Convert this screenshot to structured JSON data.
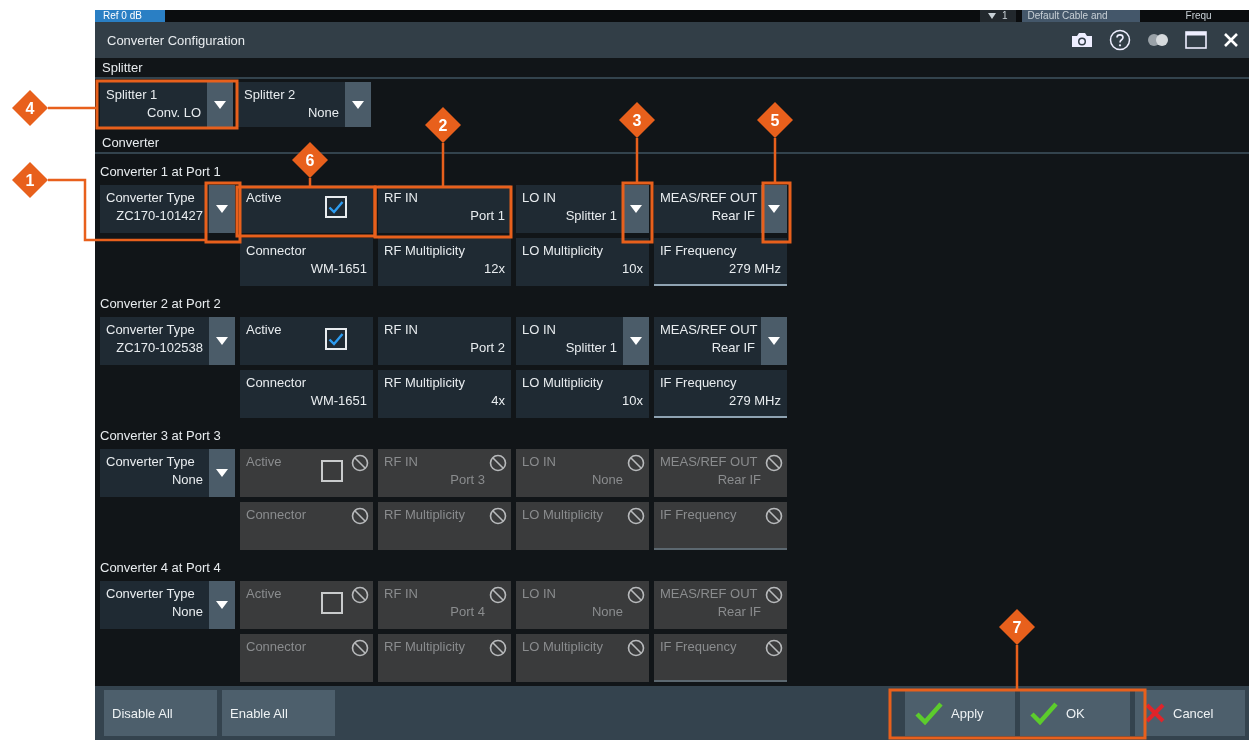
{
  "background_strip": {
    "tab": "Ref 0 dB",
    "channel": "1",
    "cable": "Default Cable and",
    "frequency": "Frequ"
  },
  "window": {
    "title": "Converter Configuration"
  },
  "splitter": {
    "heading": "Splitter",
    "items": [
      {
        "label": "Splitter 1",
        "value": "Conv. LO"
      },
      {
        "label": "Splitter 2",
        "value": "None"
      }
    ]
  },
  "converter": {
    "heading": "Converter",
    "groups": [
      {
        "title": "Converter 1 at Port 1",
        "type": {
          "label": "Converter Type",
          "value": "ZC170-101427"
        },
        "cells": [
          {
            "kind": "checkbox",
            "label": "Active",
            "checked": true,
            "disabled": false
          },
          {
            "kind": "value",
            "label": "RF IN",
            "value": "Port 1",
            "disabled": false
          },
          {
            "kind": "dropdown",
            "label": "LO IN",
            "value": "Splitter 1",
            "disabled": false
          },
          {
            "kind": "dropdown",
            "label": "MEAS/REF OUT",
            "value": "Rear IF",
            "disabled": false
          },
          {
            "kind": "value",
            "label": "Connector",
            "value": "WM-1651",
            "disabled": false
          },
          {
            "kind": "value",
            "label": "RF Multiplicity",
            "value": "12x",
            "disabled": false
          },
          {
            "kind": "value",
            "label": "LO Multiplicity",
            "value": "10x",
            "disabled": false
          },
          {
            "kind": "field",
            "label": "IF Frequency",
            "value": "279 MHz",
            "disabled": false
          }
        ]
      },
      {
        "title": "Converter 2 at Port 2",
        "type": {
          "label": "Converter Type",
          "value": "ZC170-102538"
        },
        "cells": [
          {
            "kind": "checkbox",
            "label": "Active",
            "checked": true,
            "disabled": false
          },
          {
            "kind": "value",
            "label": "RF IN",
            "value": "Port 2",
            "disabled": false
          },
          {
            "kind": "dropdown",
            "label": "LO IN",
            "value": "Splitter 1",
            "disabled": false
          },
          {
            "kind": "dropdown",
            "label": "MEAS/REF OUT",
            "value": "Rear IF",
            "disabled": false
          },
          {
            "kind": "value",
            "label": "Connector",
            "value": "WM-1651",
            "disabled": false
          },
          {
            "kind": "value",
            "label": "RF Multiplicity",
            "value": "4x",
            "disabled": false
          },
          {
            "kind": "value",
            "label": "LO Multiplicity",
            "value": "10x",
            "disabled": false
          },
          {
            "kind": "field",
            "label": "IF Frequency",
            "value": "279 MHz",
            "disabled": false
          }
        ]
      },
      {
        "title": "Converter 3 at Port 3",
        "type": {
          "label": "Converter Type",
          "value": "None"
        },
        "cells": [
          {
            "kind": "checkbox",
            "label": "Active",
            "checked": false,
            "disabled": true
          },
          {
            "kind": "value",
            "label": "RF IN",
            "value": "Port 3",
            "disabled": true
          },
          {
            "kind": "dropdown",
            "label": "LO IN",
            "value": "None",
            "disabled": true
          },
          {
            "kind": "dropdown",
            "label": "MEAS/REF OUT",
            "value": "Rear IF",
            "disabled": true
          },
          {
            "kind": "value",
            "label": "Connector",
            "disabled": true
          },
          {
            "kind": "value",
            "label": "RF Multiplicity",
            "disabled": true
          },
          {
            "kind": "value",
            "label": "LO Multiplicity",
            "disabled": true
          },
          {
            "kind": "field",
            "label": "IF Frequency",
            "disabled": true
          }
        ]
      },
      {
        "title": "Converter 4 at Port 4",
        "type": {
          "label": "Converter Type",
          "value": "None"
        },
        "cells": [
          {
            "kind": "checkbox",
            "label": "Active",
            "checked": false,
            "disabled": true
          },
          {
            "kind": "value",
            "label": "RF IN",
            "value": "Port 4",
            "disabled": true
          },
          {
            "kind": "dropdown",
            "label": "LO IN",
            "value": "None",
            "disabled": true
          },
          {
            "kind": "dropdown",
            "label": "MEAS/REF OUT",
            "value": "Rear IF",
            "disabled": true
          },
          {
            "kind": "value",
            "label": "Connector",
            "disabled": true
          },
          {
            "kind": "value",
            "label": "RF Multiplicity",
            "disabled": true
          },
          {
            "kind": "value",
            "label": "LO Multiplicity",
            "disabled": true
          },
          {
            "kind": "field",
            "label": "IF Frequency",
            "disabled": true
          }
        ]
      }
    ]
  },
  "footer": {
    "left_buttons": [
      "Disable All",
      "Enable All"
    ],
    "right_buttons": [
      {
        "kind": "confirm",
        "label": "Apply"
      },
      {
        "kind": "confirm",
        "label": "OK"
      },
      {
        "kind": "cancel",
        "label": "Cancel"
      }
    ]
  },
  "callouts": [
    {
      "number": "4"
    },
    {
      "number": "1"
    },
    {
      "number": "6"
    },
    {
      "number": "2"
    },
    {
      "number": "3"
    },
    {
      "number": "5"
    },
    {
      "number": "7"
    }
  ]
}
